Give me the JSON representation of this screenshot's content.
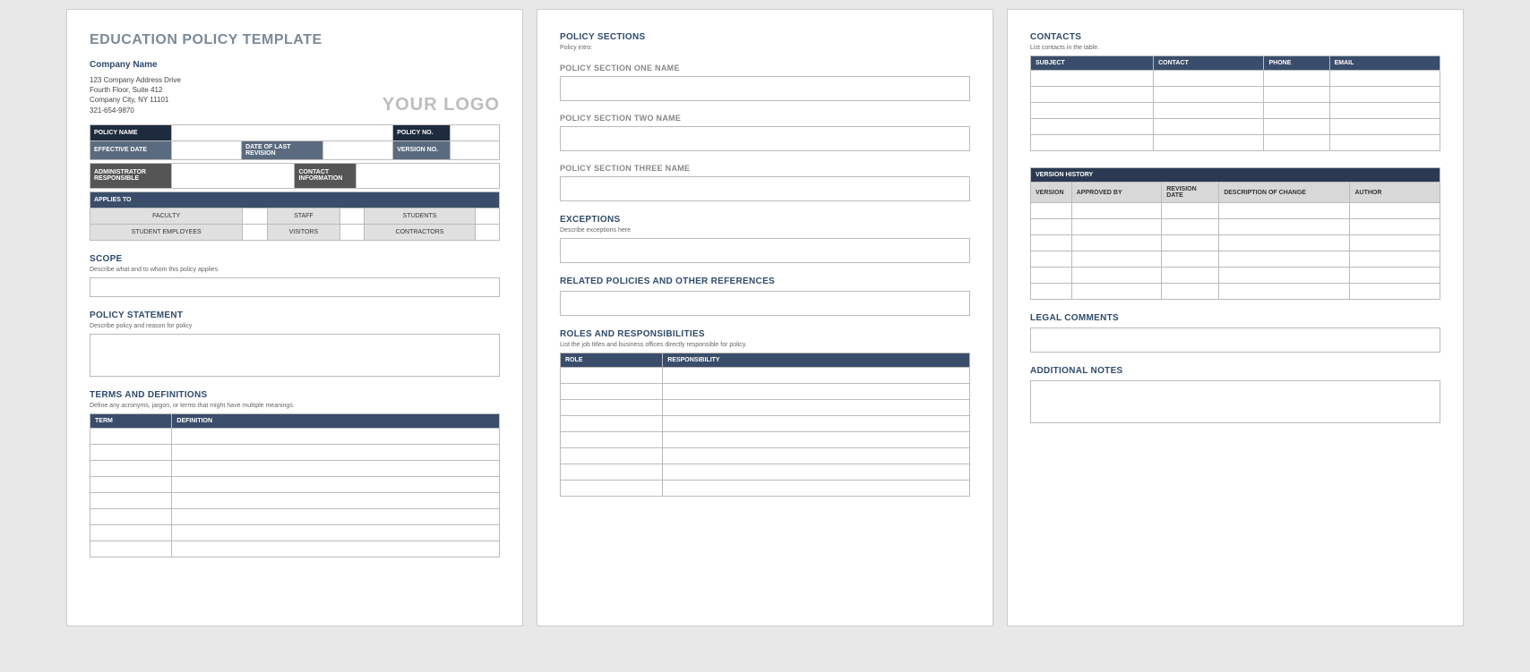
{
  "page1": {
    "title": "EDUCATION POLICY TEMPLATE",
    "company_name": "Company Name",
    "addr1": "123 Company Address Drive",
    "addr2": "Fourth Floor, Suite 412",
    "addr3": "Company City, NY  11101",
    "phone": "321-654-9870",
    "logo": "YOUR LOGO",
    "meta": {
      "policy_name": "POLICY NAME",
      "policy_no": "POLICY NO.",
      "effective_date": "EFFECTIVE DATE",
      "date_last_revision": "DATE OF LAST REVISION",
      "version_no": "VERSION NO.",
      "admin": "ADMINISTRATOR RESPONSIBLE",
      "contact": "CONTACT INFORMATION",
      "applies_to": "APPLIES TO",
      "faculty": "FACULTY",
      "staff": "STAFF",
      "students": "STUDENTS",
      "student_emp": "STUDENT EMPLOYEES",
      "visitors": "VISITORS",
      "contractors": "CONTRACTORS"
    },
    "scope": {
      "title": "SCOPE",
      "sub": "Describe what and to whom this policy applies"
    },
    "policy_statement": {
      "title": "POLICY STATEMENT",
      "sub": "Describe policy and reason for policy"
    },
    "terms": {
      "title": "TERMS AND DEFINITIONS",
      "sub": "Define any acronyms, jargon, or terms that might have multiple meanings.",
      "col_term": "TERM",
      "col_def": "DEFINITION"
    }
  },
  "page2": {
    "policy_sections": {
      "title": "POLICY SECTIONS",
      "sub": "Policy intro:",
      "s1": "POLICY SECTION ONE NAME",
      "s2": "POLICY SECTION TWO NAME",
      "s3": "POLICY SECTION THREE NAME"
    },
    "exceptions": {
      "title": "EXCEPTIONS",
      "sub": "Describe exceptions here"
    },
    "related": {
      "title": "RELATED POLICIES AND OTHER REFERENCES"
    },
    "roles": {
      "title": "ROLES AND RESPONSIBILITIES",
      "sub": "List the job titles and business offices directly responsible for policy.",
      "col_role": "ROLE",
      "col_resp": "RESPONSIBILITY"
    }
  },
  "page3": {
    "contacts": {
      "title": "CONTACTS",
      "sub": "List contacts in the table.",
      "col_subject": "SUBJECT",
      "col_contact": "CONTACT",
      "col_phone": "PHONE",
      "col_email": "EMAIL"
    },
    "version_history": {
      "header": "VERSION HISTORY",
      "col_version": "VERSION",
      "col_approved": "APPROVED BY",
      "col_revdate": "REVISION DATE",
      "col_desc": "DESCRIPTION OF CHANGE",
      "col_author": "AUTHOR"
    },
    "legal": {
      "title": "LEGAL COMMENTS"
    },
    "notes": {
      "title": "ADDITIONAL NOTES"
    }
  }
}
